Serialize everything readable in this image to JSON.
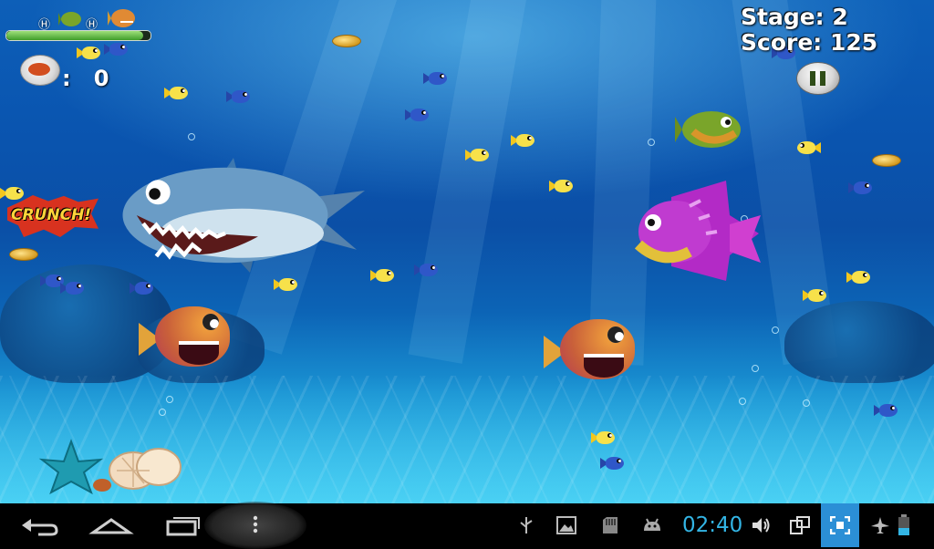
{
  "hud": {
    "stage_label": "Stage: 2",
    "score_label": "Score: 125",
    "crunch_count_separator": ":",
    "crunch_count": "0",
    "growth_progress": 0.95
  },
  "crunch_text": "CRUNCH!",
  "system_bar": {
    "clock": "02:40",
    "nav": [
      "back-icon",
      "home-icon",
      "recent-apps-icon",
      "menu-icon"
    ],
    "status_icons": [
      "usb-icon",
      "gallery-icon",
      "sd-card-icon",
      "android-debug-icon",
      "volume-icon",
      "screen-rotate-icon",
      "fullscreen-icon",
      "airplane-icon",
      "battery-icon"
    ],
    "accent_color": "#33b5e5"
  }
}
